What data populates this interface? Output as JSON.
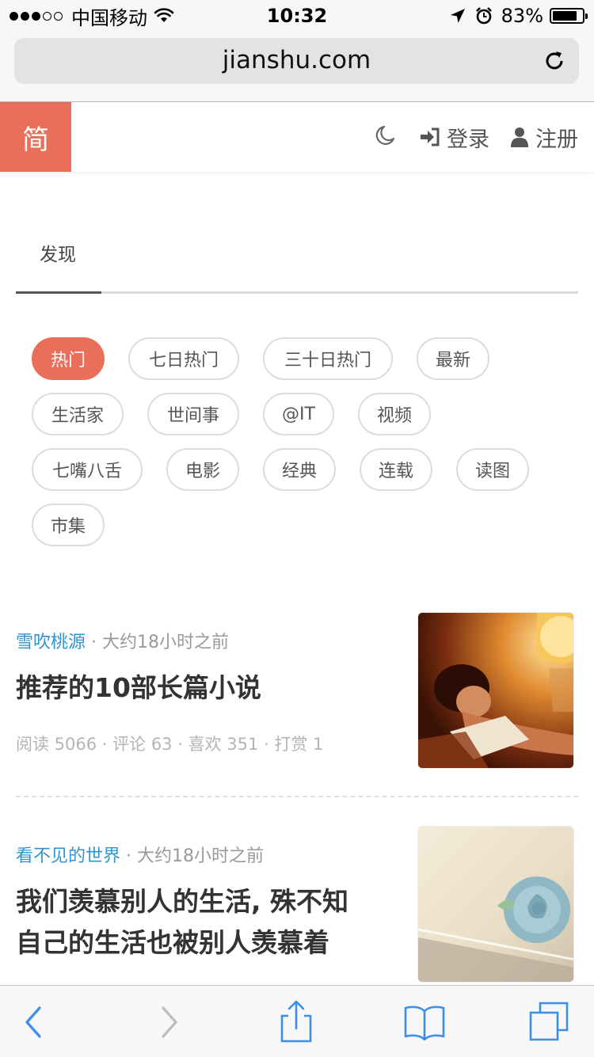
{
  "status_bar": {
    "carrier": "中国移动",
    "time": "10:32",
    "battery": "83%",
    "battery_level": 0.83
  },
  "browser": {
    "url": "jianshu.com"
  },
  "header": {
    "logo": "简",
    "login_label": "登录",
    "register_label": "注册"
  },
  "discover": {
    "tab_label": "发现",
    "tags": [
      "热门",
      "七日热门",
      "三十日热门",
      "最新",
      "生活家",
      "世间事",
      "@IT",
      "视频",
      "七嘴八舌",
      "电影",
      "经典",
      "连载",
      "读图",
      "市集"
    ]
  },
  "articles": [
    {
      "author": "雪吹桃源",
      "time": "大约18小时之前",
      "title": "推荐的10部长篇小说",
      "stats": "阅读 5066 · 评论 63 · 喜欢 351 · 打赏 1"
    },
    {
      "author": "看不见的世界",
      "time": "大约18小时之前",
      "title_line1": "我们羡慕别人的生活, 殊不知",
      "title_line2": "自己的生活也被别人羡慕着"
    }
  ],
  "colors": {
    "accent": "#ea6f5a",
    "link": "#3194d0",
    "safari_blue": "#3b8fe8"
  },
  "icons": [
    "wifi-icon",
    "location-arrow-icon",
    "alarm-clock-icon",
    "battery-icon",
    "reload-icon",
    "moon-icon",
    "sign-in-icon",
    "user-icon",
    "back-icon",
    "forward-icon",
    "share-icon",
    "bookmarks-icon",
    "tabs-icon"
  ]
}
